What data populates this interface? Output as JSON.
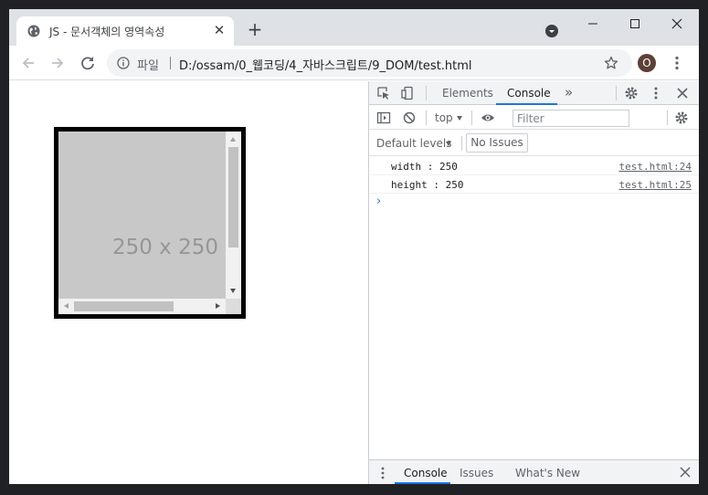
{
  "browser": {
    "tab": {
      "title": "JS - 문서객체의 영역속성",
      "favicon": "globe-icon",
      "close_icon": "close-icon"
    },
    "new_tab_label": "+",
    "omnibox": {
      "scheme_label": "파일",
      "url": "D:/ossam/0_웹코딩/4_자바스크립트/9_DOM/test.html"
    },
    "profile_initial": "O"
  },
  "page": {
    "placeholder_text": "250 x 250"
  },
  "devtools": {
    "tabs": [
      {
        "label": "Elements",
        "active": false
      },
      {
        "label": "Console",
        "active": true
      }
    ],
    "context": "top",
    "filter_placeholder": "Filter",
    "levels_label": "Default levels",
    "issues_label": "No Issues",
    "logs": [
      {
        "message": "width : 250",
        "source": "test.html:24"
      },
      {
        "message": "height : 250",
        "source": "test.html:25"
      }
    ],
    "prompt": "›",
    "drawer_tabs": [
      {
        "label": "Console",
        "active": true
      },
      {
        "label": "Issues",
        "active": false
      },
      {
        "label": "What's New",
        "active": false
      }
    ]
  },
  "colors": {
    "accent": "#1a73e8",
    "chrome_frame": "#dee1e6",
    "avatar": "#5d4037",
    "placeholder_bg": "#c8c8c8"
  }
}
